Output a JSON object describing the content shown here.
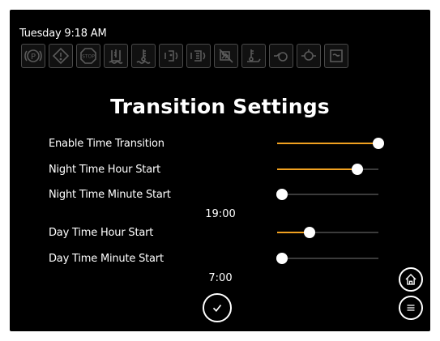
{
  "status": {
    "datetime": "Tuesday 9:18 AM"
  },
  "telltales": [
    {
      "icon": "parking-brake-icon",
      "text": "(P)"
    },
    {
      "icon": "warning-icon",
      "text": "!"
    },
    {
      "icon": "stop-icon",
      "text": "STOP"
    },
    {
      "icon": "coolant-level-icon"
    },
    {
      "icon": "coolant-temperature-icon"
    },
    {
      "icon": "def-fluid-icon"
    },
    {
      "icon": "def-filter-icon"
    },
    {
      "icon": "regen-inhibit-icon"
    },
    {
      "icon": "exhaust-temperature-icon"
    },
    {
      "icon": "oil-pressure-icon"
    },
    {
      "icon": "transmission-icon"
    },
    {
      "icon": "dpf-icon"
    }
  ],
  "page": {
    "title": "Transition Settings"
  },
  "settings": [
    {
      "label": "Enable Time Transition",
      "level": 1.0
    },
    {
      "label": "Night Time Hour Start",
      "level": 0.79
    },
    {
      "label": "Night Time Minute Start",
      "level": 0.05,
      "readout": "19:00"
    },
    {
      "label": "Day Time Hour Start",
      "level": 0.32
    },
    {
      "label": "Day Time Minute Start",
      "level": 0.05,
      "readout": "7:00"
    }
  ],
  "colors": {
    "accent": "#f0a020",
    "background": "#000000",
    "track": "#3b3b3b",
    "text": "#ffffff"
  },
  "buttons": {
    "confirm_icon": "check-icon",
    "home_icon": "home-icon",
    "menu_icon": "menu-icon"
  }
}
